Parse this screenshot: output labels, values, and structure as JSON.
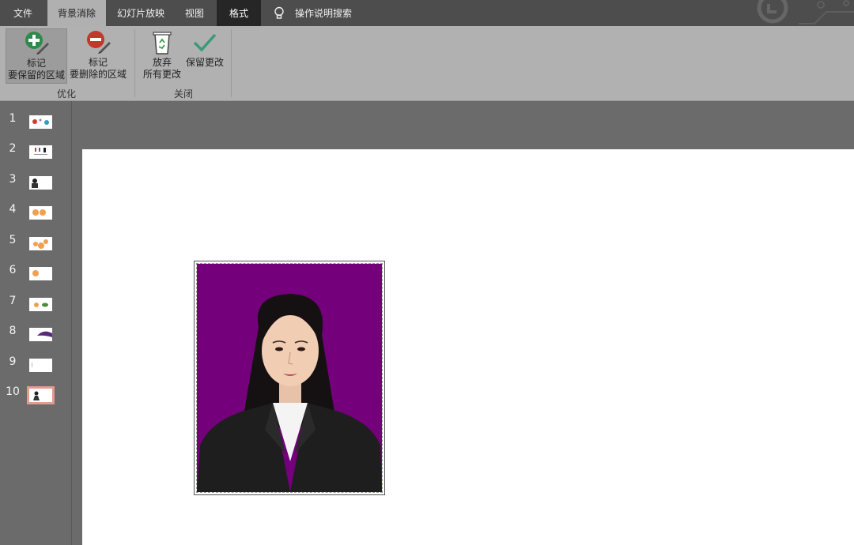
{
  "tabs": [
    {
      "label": "文件",
      "state": "normal"
    },
    {
      "label": "背景消除",
      "state": "active"
    },
    {
      "label": "幻灯片放映",
      "state": "normal"
    },
    {
      "label": "视图",
      "state": "normal"
    },
    {
      "label": "格式",
      "state": "dark"
    }
  ],
  "tell_me": {
    "label": "操作说明搜索",
    "icon": "lightbulb-icon"
  },
  "ribbon": {
    "mark_keep": {
      "line1": "标记",
      "line2": "要保留的区域",
      "icon": "plus-pencil-icon"
    },
    "mark_remove": {
      "line1": "标记",
      "line2": "要删除的区域",
      "icon": "minus-pencil-icon"
    },
    "discard": {
      "line1": "放弃",
      "line2": "所有更改",
      "icon": "recycle-bin-icon"
    },
    "keep": {
      "line1": "保留更改",
      "icon": "checkmark-icon"
    },
    "group_refine": "优化",
    "group_close": "关闭"
  },
  "slides": [
    {
      "num": "1"
    },
    {
      "num": "2"
    },
    {
      "num": "3"
    },
    {
      "num": "4"
    },
    {
      "num": "5"
    },
    {
      "num": "6"
    },
    {
      "num": "7"
    },
    {
      "num": "8"
    },
    {
      "num": "9"
    },
    {
      "num": "10",
      "selected": true
    }
  ],
  "colors": {
    "photo_background": "#74007c",
    "accent_selection": "#e29b8c",
    "add_icon": "#2f8a4c",
    "remove_icon": "#c0392b",
    "check_icon": "#3a9a7a"
  }
}
